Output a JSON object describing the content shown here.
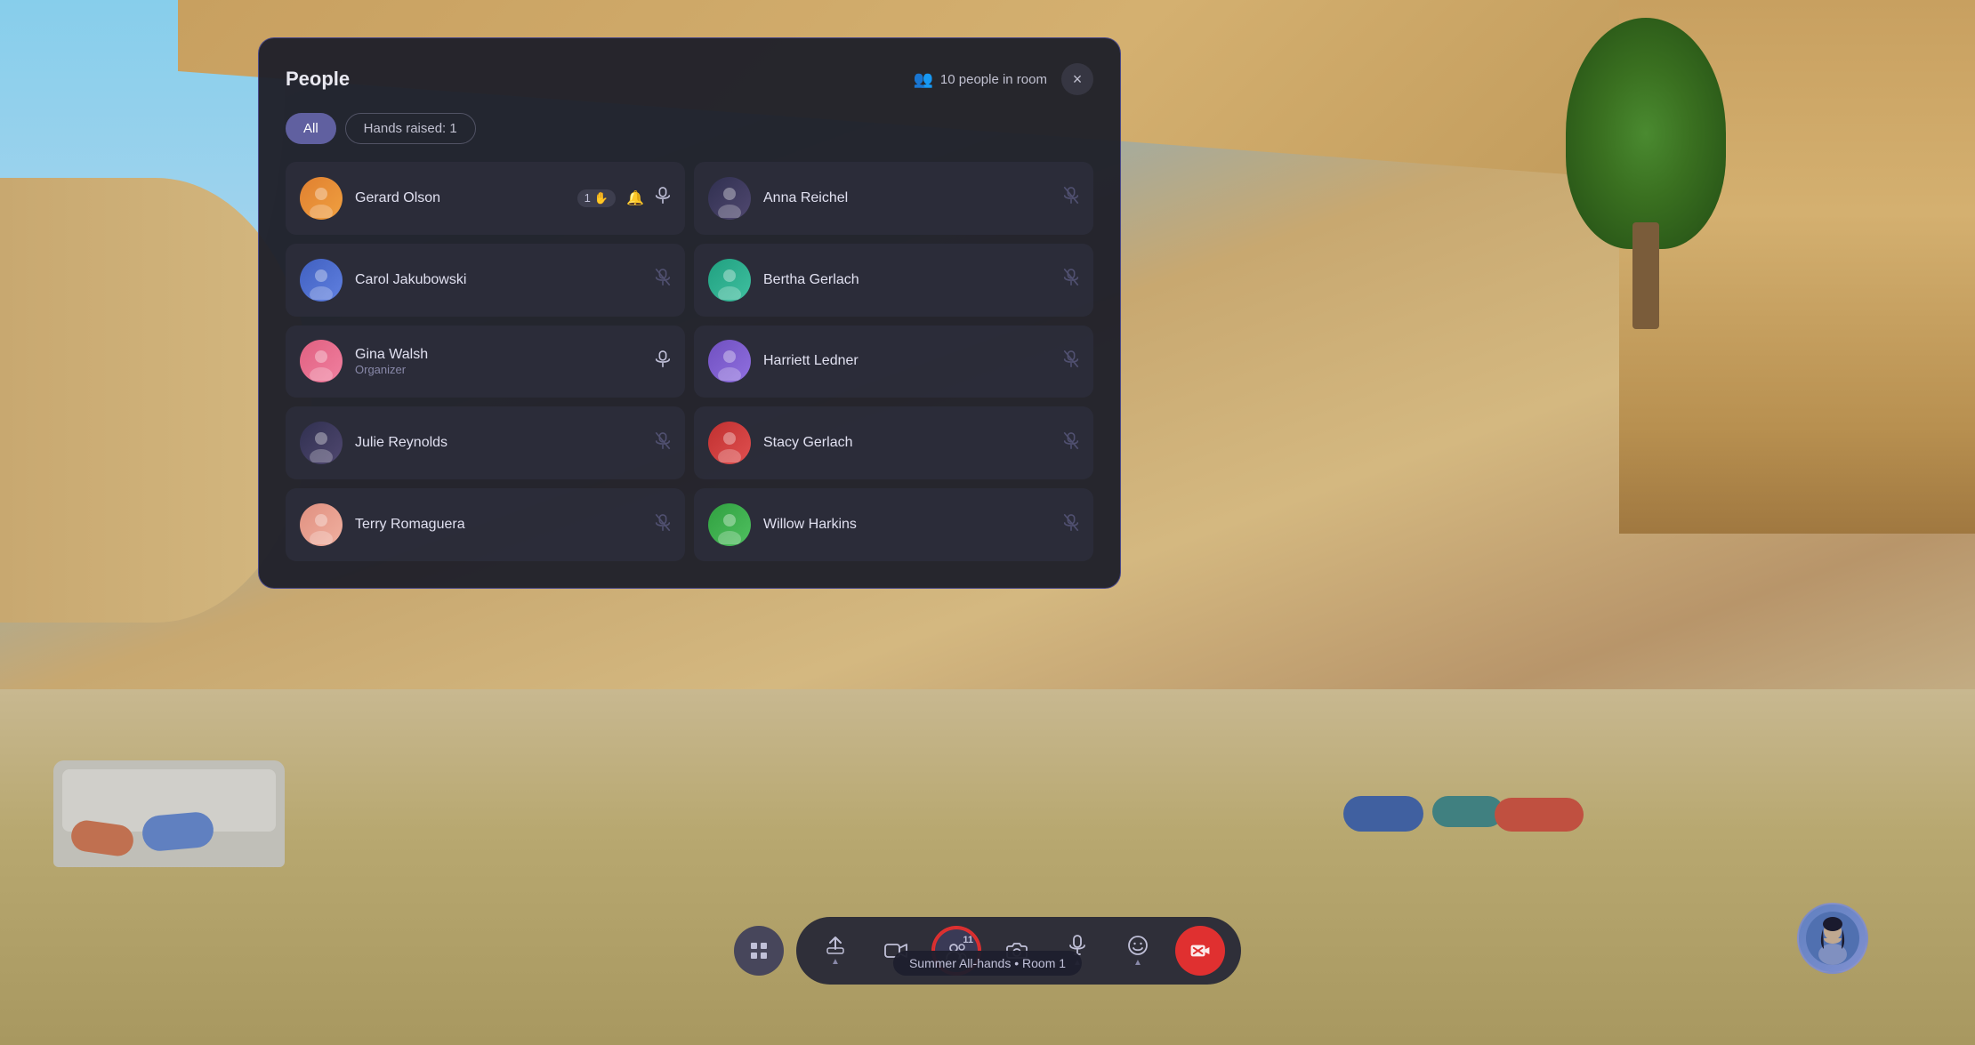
{
  "background": {
    "description": "Virtual meeting room environment"
  },
  "panel": {
    "title": "People",
    "people_count": "10 people in room",
    "close_label": "×"
  },
  "filters": {
    "all_label": "All",
    "hands_label": "Hands raised: 1"
  },
  "people": [
    {
      "name": "Gerard Olson",
      "role": "",
      "avatar_class": "av-orange",
      "emoji": "🧑",
      "hand_count": "1",
      "has_hand": true,
      "has_bell": true,
      "mic": "on",
      "col": 0
    },
    {
      "name": "Anna Reichel",
      "role": "",
      "avatar_class": "av-dark",
      "emoji": "👩",
      "has_hand": false,
      "has_bell": false,
      "mic": "off",
      "col": 1
    },
    {
      "name": "Carol Jakubowski",
      "role": "",
      "avatar_class": "av-blue",
      "emoji": "👩",
      "has_hand": false,
      "has_bell": false,
      "mic": "off",
      "col": 0
    },
    {
      "name": "Bertha Gerlach",
      "role": "",
      "avatar_class": "av-teal",
      "emoji": "👩",
      "has_hand": false,
      "has_bell": false,
      "mic": "off",
      "col": 1
    },
    {
      "name": "Gina Walsh",
      "role": "Organizer",
      "avatar_class": "av-pink",
      "emoji": "👩",
      "has_hand": false,
      "has_bell": false,
      "mic": "on",
      "col": 0
    },
    {
      "name": "Harriett Ledner",
      "role": "",
      "avatar_class": "av-purple",
      "emoji": "👩",
      "has_hand": false,
      "has_bell": false,
      "mic": "off",
      "col": 1
    },
    {
      "name": "Julie Reynolds",
      "role": "",
      "avatar_class": "av-dark",
      "emoji": "👩",
      "has_hand": false,
      "has_bell": false,
      "mic": "off",
      "col": 0
    },
    {
      "name": "Stacy Gerlach",
      "role": "",
      "avatar_class": "av-red",
      "emoji": "👩",
      "has_hand": false,
      "has_bell": false,
      "mic": "off",
      "col": 1
    },
    {
      "name": "Terry Romaguera",
      "role": "",
      "avatar_class": "av-salmon",
      "emoji": "🧔",
      "has_hand": false,
      "has_bell": false,
      "mic": "off",
      "col": 0
    },
    {
      "name": "Willow Harkins",
      "role": "",
      "avatar_class": "av-green",
      "emoji": "👩",
      "has_hand": false,
      "has_bell": false,
      "mic": "off",
      "col": 1
    }
  ],
  "toolbar": {
    "grid_icon": "⊞",
    "share_icon": "↑",
    "film_icon": "🎬",
    "people_icon": "👥",
    "people_count": "11",
    "camera_icon": "📷",
    "mic_icon": "🎙",
    "emoji_icon": "😊",
    "end_icon": "📋",
    "tooltip": "Summer All-hands • Room 1"
  },
  "self_avatar": {
    "emoji": "👩"
  }
}
